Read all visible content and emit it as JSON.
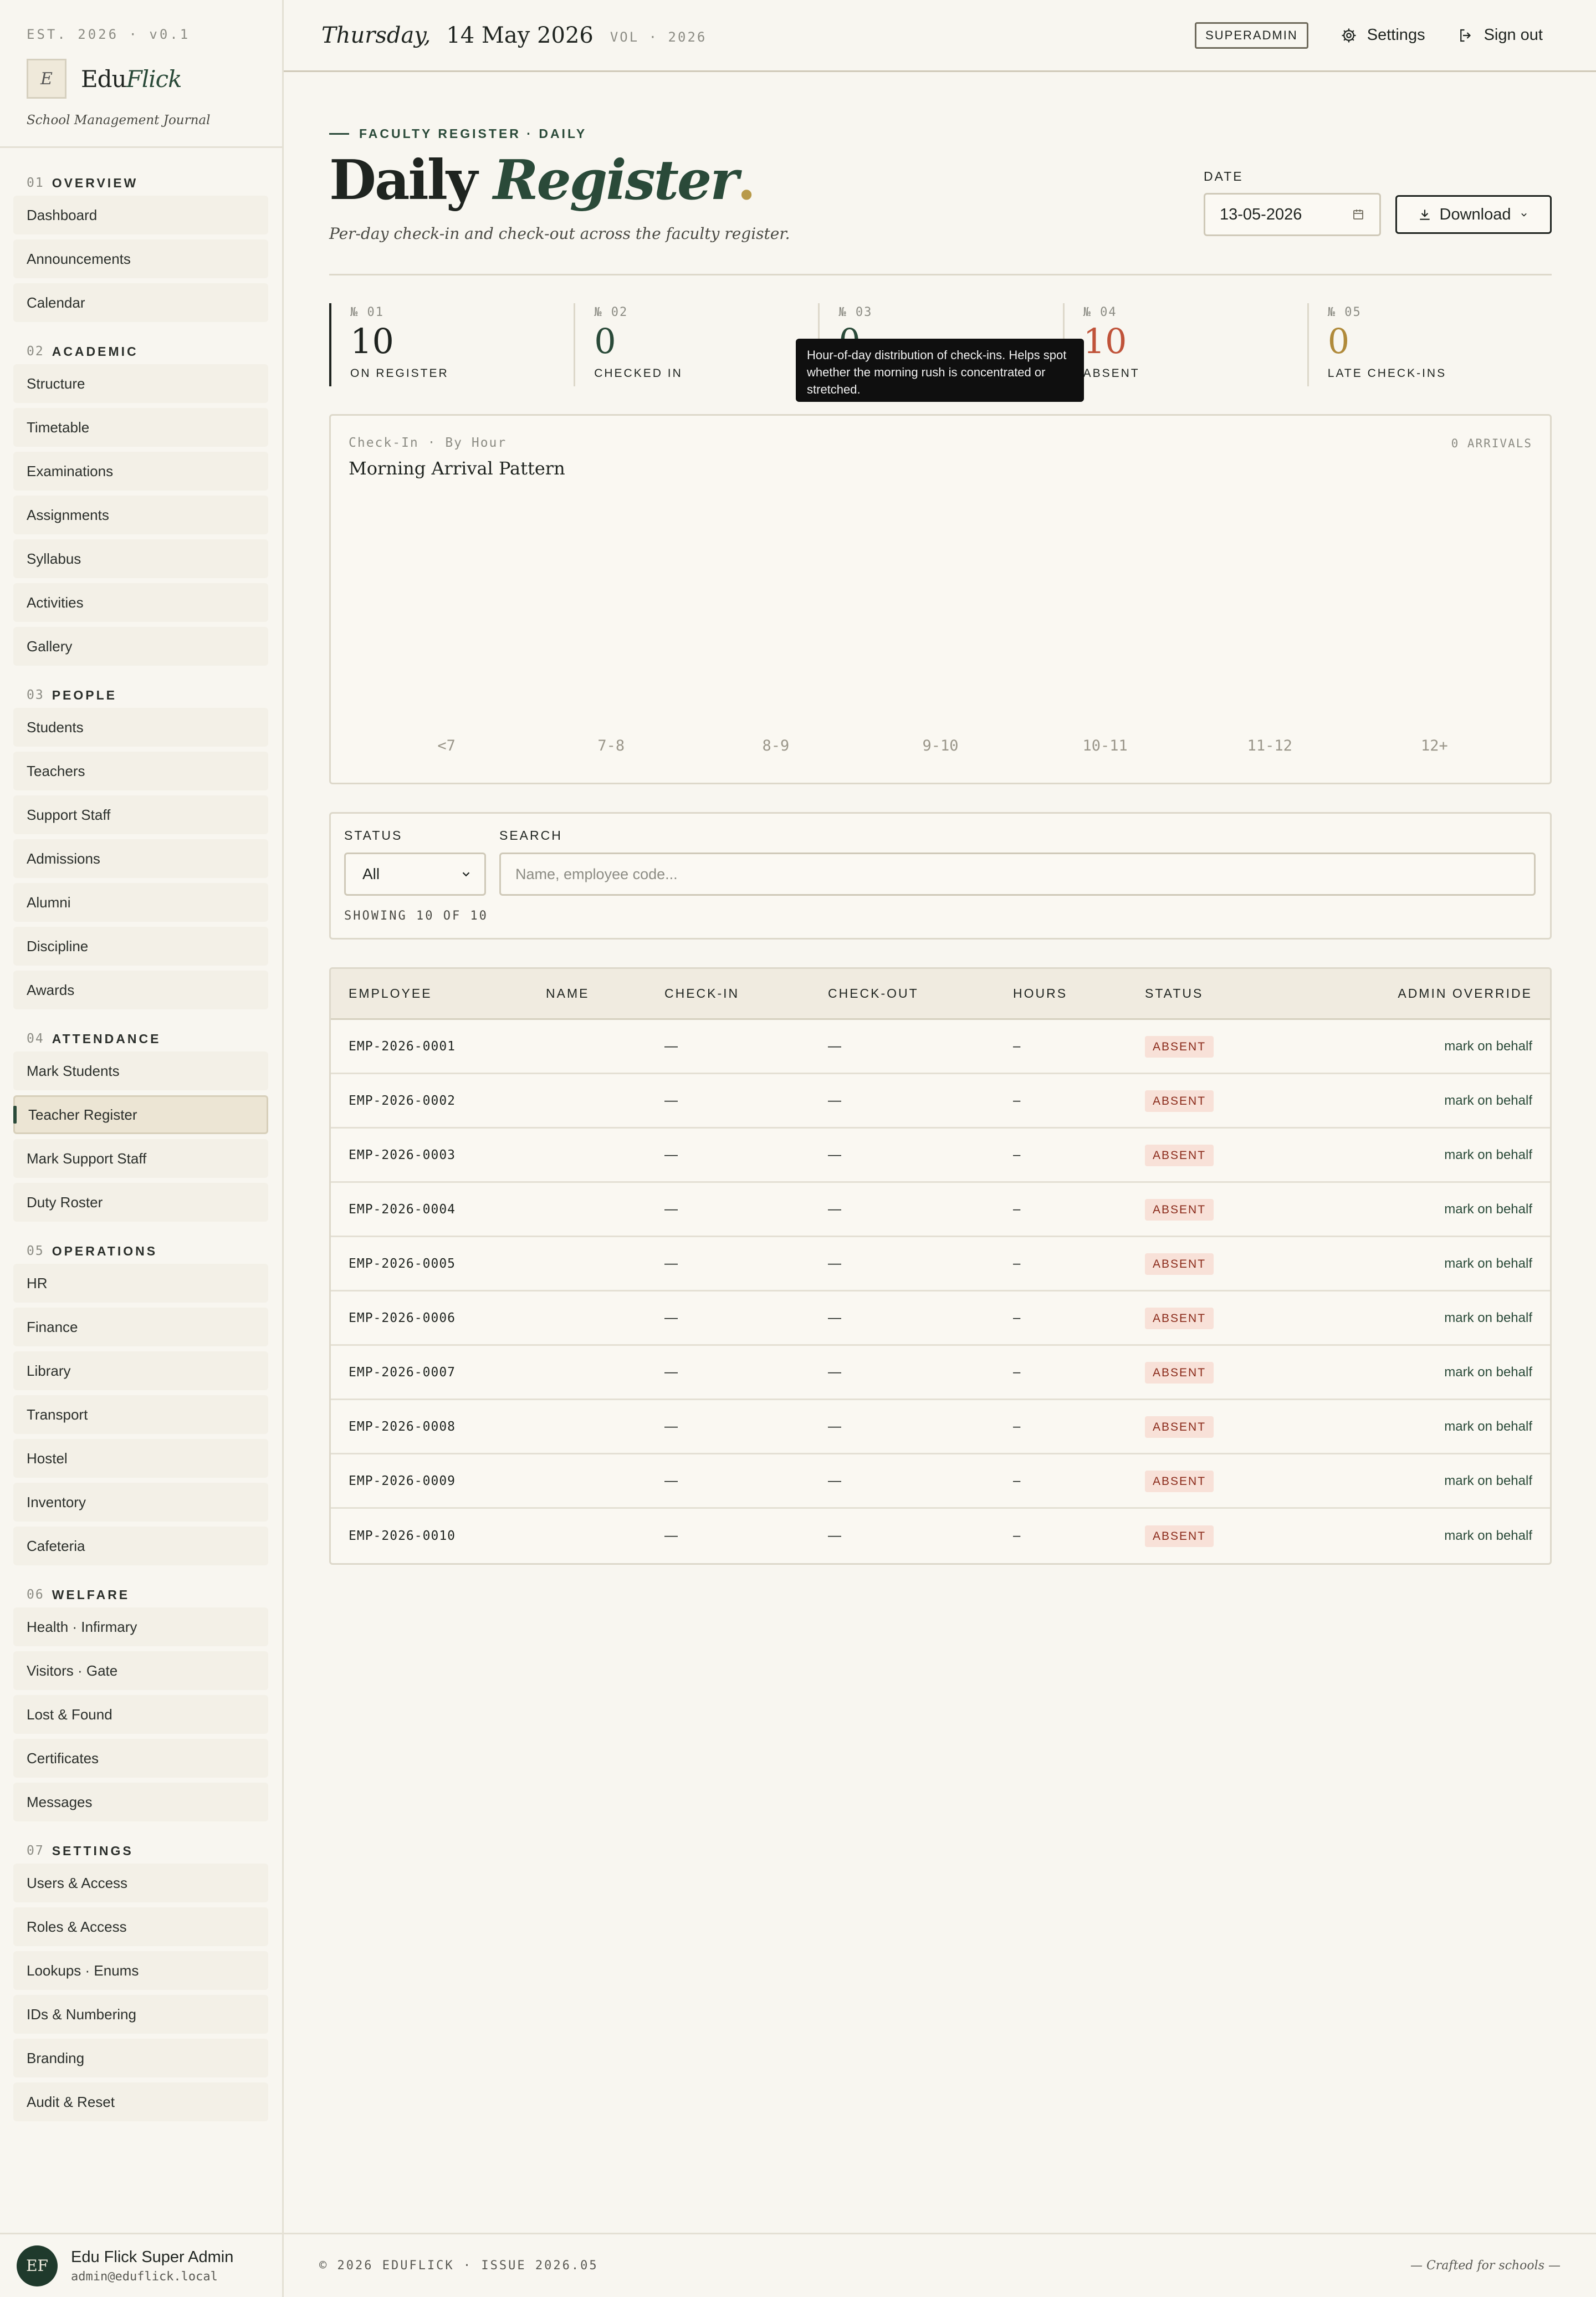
{
  "brand": {
    "est": "EST. 2026 · v0.1",
    "logo_letter": "E",
    "name_main": "Edu",
    "name_italic": "Flick",
    "tagline": "School Management Journal"
  },
  "nav": [
    {
      "num": "01",
      "label": "OVERVIEW",
      "items": [
        "Dashboard",
        "Announcements",
        "Calendar"
      ]
    },
    {
      "num": "02",
      "label": "ACADEMIC",
      "items": [
        "Structure",
        "Timetable",
        "Examinations",
        "Assignments",
        "Syllabus",
        "Activities",
        "Gallery"
      ]
    },
    {
      "num": "03",
      "label": "PEOPLE",
      "items": [
        "Students",
        "Teachers",
        "Support Staff",
        "Admissions",
        "Alumni",
        "Discipline",
        "Awards"
      ]
    },
    {
      "num": "04",
      "label": "ATTENDANCE",
      "items": [
        "Mark Students",
        "Teacher Register",
        "Mark Support Staff",
        "Duty Roster"
      ]
    },
    {
      "num": "05",
      "label": "OPERATIONS",
      "items": [
        "HR",
        "Finance",
        "Library",
        "Transport",
        "Hostel",
        "Inventory",
        "Cafeteria"
      ]
    },
    {
      "num": "06",
      "label": "WELFARE",
      "items": [
        "Health · Infirmary",
        "Visitors · Gate",
        "Lost & Found",
        "Certificates",
        "Messages"
      ]
    },
    {
      "num": "07",
      "label": "SETTINGS",
      "items": [
        "Users & Access",
        "Roles & Access",
        "Lookups · Enums",
        "IDs & Numbering",
        "Branding",
        "Audit & Reset"
      ]
    }
  ],
  "active_nav": "Teacher Register",
  "user": {
    "initials": "EF",
    "name": "Edu Flick Super Admin",
    "email": "admin@eduflick.local"
  },
  "topbar": {
    "day": "Thursday,",
    "date": "14 May 2026",
    "vol": "VOL · 2026",
    "role": "SUPERADMIN",
    "settings": "Settings",
    "signout": "Sign out"
  },
  "page": {
    "eyebrow": "FACULTY REGISTER · DAILY",
    "title_main": "Daily ",
    "title_italic": "Register",
    "title_dot": ".",
    "subtitle": "Per-day check-in and check-out across the faculty register.",
    "date_label": "DATE",
    "date_value": "13-05-2026",
    "download": "Download"
  },
  "kpis": [
    {
      "num": "№ 01",
      "value": "10",
      "label": "ON REGISTER",
      "color": "#1f2420"
    },
    {
      "num": "№ 02",
      "value": "0",
      "label": "CHECKED IN",
      "color": "#2a4a39"
    },
    {
      "num": "№ 03",
      "value": "0",
      "label": "",
      "color": "#2a4a39"
    },
    {
      "num": "№ 04",
      "value": "10",
      "label": "ABSENT",
      "color": "#c0533a"
    },
    {
      "num": "№ 05",
      "value": "0",
      "label": "LATE CHECK-INS",
      "color": "#b08a3a"
    }
  ],
  "tooltip": "Hour-of-day distribution of check-ins. Helps spot whether the morning rush is concentrated or stretched.",
  "chart_data": {
    "type": "bar",
    "eyebrow": "Check-In · By Hour",
    "title": "Morning Arrival Pattern",
    "count_label": "0 ARRIVALS",
    "categories": [
      "<7",
      "7-8",
      "8-9",
      "9-10",
      "10-11",
      "11-12",
      "12+"
    ],
    "values": [
      0,
      0,
      0,
      0,
      0,
      0,
      0
    ]
  },
  "filters": {
    "status_label": "STATUS",
    "status_value": "All",
    "search_label": "SEARCH",
    "search_placeholder": "Name, employee code...",
    "showing": "SHOWING 10 OF 10"
  },
  "table": {
    "headers": [
      "EMPLOYEE",
      "NAME",
      "CHECK-IN",
      "CHECK-OUT",
      "HOURS",
      "STATUS",
      "ADMIN OVERRIDE"
    ],
    "rows": [
      {
        "emp": "EMP-2026-0001",
        "name": "",
        "in": "—",
        "out": "—",
        "hours": "–",
        "status": "ABSENT",
        "override": "mark on behalf"
      },
      {
        "emp": "EMP-2026-0002",
        "name": "",
        "in": "—",
        "out": "—",
        "hours": "–",
        "status": "ABSENT",
        "override": "mark on behalf"
      },
      {
        "emp": "EMP-2026-0003",
        "name": "",
        "in": "—",
        "out": "—",
        "hours": "–",
        "status": "ABSENT",
        "override": "mark on behalf"
      },
      {
        "emp": "EMP-2026-0004",
        "name": "",
        "in": "—",
        "out": "—",
        "hours": "–",
        "status": "ABSENT",
        "override": "mark on behalf"
      },
      {
        "emp": "EMP-2026-0005",
        "name": "",
        "in": "—",
        "out": "—",
        "hours": "–",
        "status": "ABSENT",
        "override": "mark on behalf"
      },
      {
        "emp": "EMP-2026-0006",
        "name": "",
        "in": "—",
        "out": "—",
        "hours": "–",
        "status": "ABSENT",
        "override": "mark on behalf"
      },
      {
        "emp": "EMP-2026-0007",
        "name": "",
        "in": "—",
        "out": "—",
        "hours": "–",
        "status": "ABSENT",
        "override": "mark on behalf"
      },
      {
        "emp": "EMP-2026-0008",
        "name": "",
        "in": "—",
        "out": "—",
        "hours": "–",
        "status": "ABSENT",
        "override": "mark on behalf"
      },
      {
        "emp": "EMP-2026-0009",
        "name": "",
        "in": "—",
        "out": "—",
        "hours": "–",
        "status": "ABSENT",
        "override": "mark on behalf"
      },
      {
        "emp": "EMP-2026-0010",
        "name": "",
        "in": "—",
        "out": "—",
        "hours": "–",
        "status": "ABSENT",
        "override": "mark on behalf"
      }
    ]
  },
  "footer": {
    "left": "© 2026 EDUFLICK · ISSUE 2026.05",
    "right": "— Crafted for schools —"
  }
}
